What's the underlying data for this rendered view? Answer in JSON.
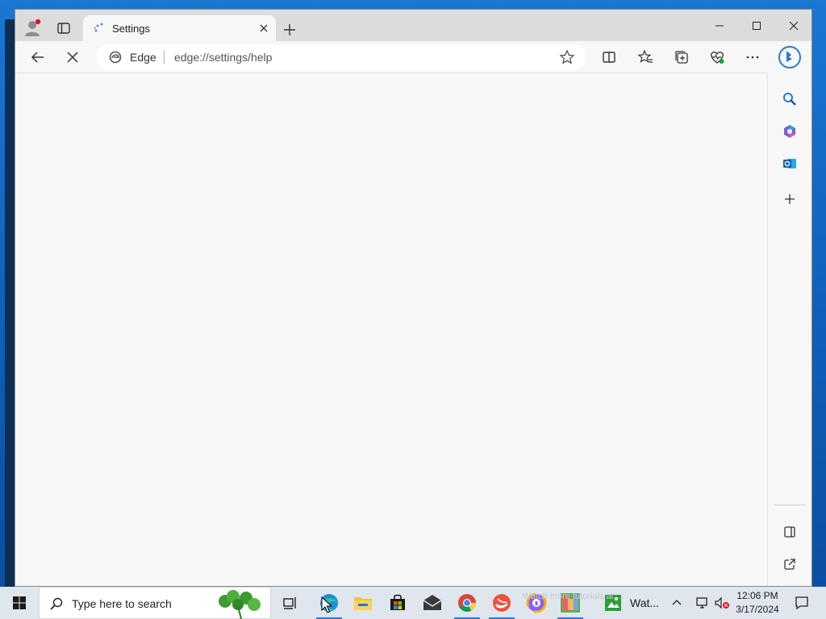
{
  "browser": {
    "tab": {
      "title": "Settings"
    },
    "address": {
      "brand": "Edge",
      "url": "edge://settings/help"
    }
  },
  "taskbar": {
    "search_placeholder": "Type here to search",
    "watch_app_label": "Wat...",
    "watermark_text": "Watch more tutorials at ...",
    "clock": {
      "time": "12:06 PM",
      "date": "3/17/2024"
    }
  },
  "colors": {
    "desktop": "#1166c4",
    "window_bg": "#f7f7f7",
    "tabstrip_bg": "#dcdcdc",
    "taskbar_bg": "#dfe6ee",
    "accent": "#2a78d6"
  },
  "icons": {
    "tabstrip": [
      "profile-icon",
      "tab-actions-icon",
      "loading-spinner-icon",
      "close-icon",
      "plus-icon"
    ],
    "window_controls": [
      "minimize-icon",
      "maximize-icon",
      "close-icon"
    ],
    "toolbar": [
      "back-arrow-icon",
      "stop-loading-icon",
      "edge-logo-icon",
      "favorite-star-icon",
      "split-screen-icon",
      "favorites-icon",
      "collections-icon",
      "browser-essentials-icon",
      "more-icon",
      "bing-copilot-icon"
    ],
    "sidebar": [
      "search-icon",
      "copilot-icon",
      "outlook-icon",
      "plus-icon",
      "sidebar-toggle-icon",
      "open-external-icon",
      "settings-gear-icon"
    ],
    "taskbar": [
      "windows-start-icon",
      "search-icon",
      "clover-icon",
      "task-view-icon",
      "edge-icon",
      "file-explorer-icon",
      "store-icon",
      "mail-icon",
      "chrome-icon",
      "swift-icon",
      "vpn-icon",
      "colorful-app-icon",
      "watch-app-icon",
      "chevron-up-icon",
      "network-icon",
      "volume-muted-icon",
      "notification-icon"
    ]
  }
}
